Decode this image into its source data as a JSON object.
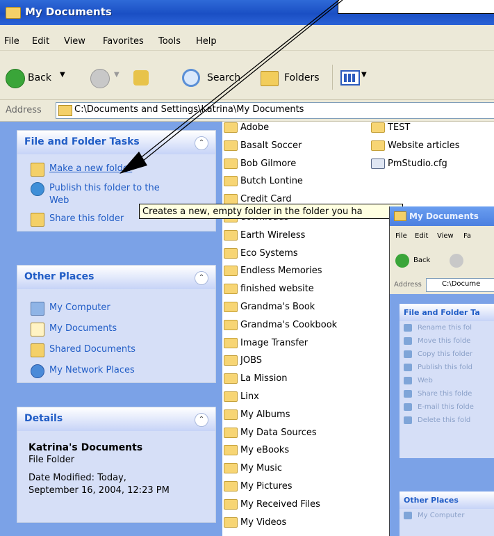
{
  "window": {
    "title": "My Documents"
  },
  "menu": [
    "File",
    "Edit",
    "View",
    "Favorites",
    "Tools",
    "Help"
  ],
  "toolbar": {
    "back": "Back",
    "search": "Search",
    "folders": "Folders"
  },
  "address": {
    "label": "Address",
    "value": "C:\\Documents and Settings\\Katrina\\My Documents"
  },
  "tasks": {
    "title": "File and Folder Tasks",
    "items": [
      "Make a new folder",
      "Publish this folder to the",
      "Web",
      "Share this folder"
    ]
  },
  "other_places": {
    "title": "Other Places",
    "items": [
      "My Computer",
      "My Documents",
      "Shared Documents",
      "My Network Places"
    ]
  },
  "details": {
    "title": "Details",
    "name": "Katrina's Documents",
    "type": "File Folder",
    "modified_line1": "Date Modified: Today,",
    "modified_line2": "September 16, 2004, 12:23 PM"
  },
  "files": {
    "col1": [
      "Adobe",
      "Basalt Soccer",
      "Bob Gilmore",
      "Butch Lontine",
      "Credit Card",
      "downloads",
      "Earth Wireless",
      "Eco Systems",
      "Endless Memories",
      "finished website",
      "Grandma's Book",
      "Grandma's Cookbook",
      "Image Transfer",
      "JOBS",
      "La Mission",
      "Linx",
      "My Albums",
      "My Data Sources",
      "My eBooks",
      "My Music",
      "My Pictures",
      "My Received Files",
      "My Videos"
    ],
    "col2": [
      "TEST",
      "Website articles",
      "PmStudio.cfg"
    ]
  },
  "tooltip": "Creates a new, empty folder in the folder you ha",
  "thumbnail": {
    "title": "My Documents",
    "menu": [
      "File",
      "Edit",
      "View",
      "Fa"
    ],
    "back": "Back",
    "address_label": "Address",
    "address_value": "C:\\Docume",
    "panel_title": "File and Folder Ta",
    "items": [
      "Rename this fol",
      "Move this folde",
      "Copy this folder",
      "Publish this fold",
      "Web",
      "Share this folde",
      "E-mail this folde",
      "Delete this fold"
    ],
    "other_title": "Other Places",
    "other_item": "My Computer"
  },
  "colors": {
    "title_bar": "#2a62d6",
    "panel_bg": "#d6dff7",
    "pane_bg": "#7ba2e7",
    "link": "#215dc6",
    "tooltip_bg": "#ffffe1"
  }
}
